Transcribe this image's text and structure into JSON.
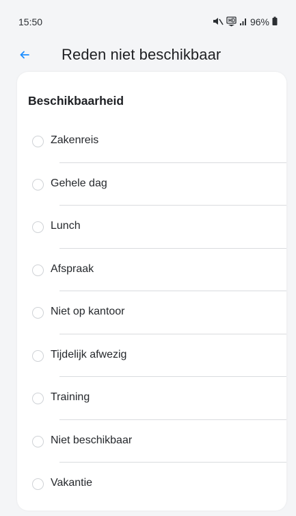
{
  "status_bar": {
    "time": "15:50",
    "battery": "96%",
    "icons": [
      "mute-icon",
      "hd-voice-icon",
      "signal-icon",
      "battery-icon"
    ]
  },
  "header": {
    "back_icon": "back-arrow-icon",
    "title": "Reden niet beschikbaar"
  },
  "card": {
    "section_title": "Beschikbaarheid",
    "options": [
      {
        "label": "Zakenreis",
        "selected": false
      },
      {
        "label": "Gehele dag",
        "selected": false
      },
      {
        "label": "Lunch",
        "selected": false
      },
      {
        "label": "Afspraak",
        "selected": false
      },
      {
        "label": "Niet op kantoor",
        "selected": false
      },
      {
        "label": "Tijdelijk afwezig",
        "selected": false
      },
      {
        "label": "Training",
        "selected": false
      },
      {
        "label": "Niet beschikbaar",
        "selected": false
      },
      {
        "label": "Vakantie",
        "selected": false
      }
    ]
  },
  "colors": {
    "background": "#f4f5f7",
    "card": "#ffffff",
    "accent": "#1a8cff",
    "divider": "#d9dbde",
    "radio_border": "#cfd2d6"
  }
}
